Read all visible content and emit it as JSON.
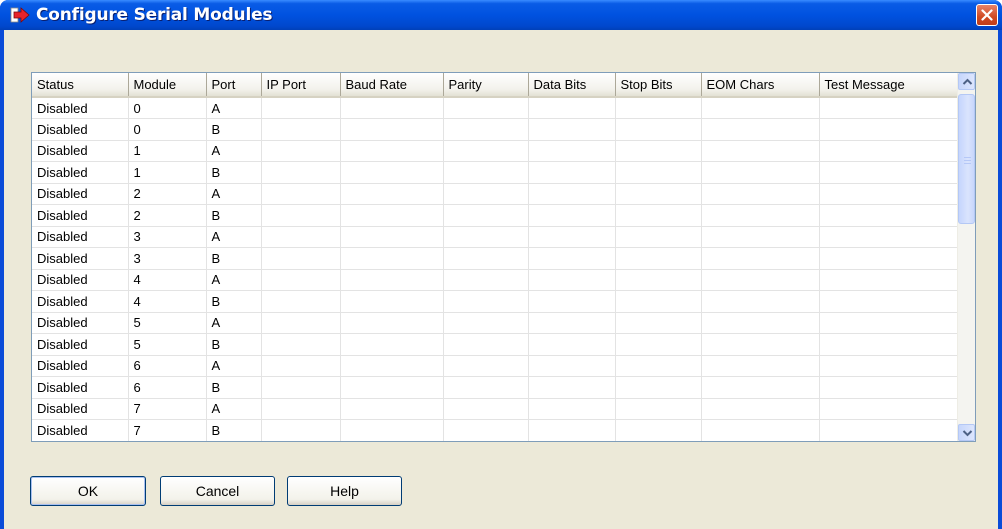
{
  "window": {
    "title": "Configure Serial Modules"
  },
  "grid": {
    "columns": [
      "Status",
      "Module",
      "Port",
      "IP Port",
      "Baud Rate",
      "Parity",
      "Data Bits",
      "Stop Bits",
      "EOM Chars",
      "Test Message"
    ],
    "rows": [
      [
        "Disabled",
        "0",
        "A",
        "",
        "",
        "",
        "",
        "",
        "",
        ""
      ],
      [
        "Disabled",
        "0",
        "B",
        "",
        "",
        "",
        "",
        "",
        "",
        ""
      ],
      [
        "Disabled",
        "1",
        "A",
        "",
        "",
        "",
        "",
        "",
        "",
        ""
      ],
      [
        "Disabled",
        "1",
        "B",
        "",
        "",
        "",
        "",
        "",
        "",
        ""
      ],
      [
        "Disabled",
        "2",
        "A",
        "",
        "",
        "",
        "",
        "",
        "",
        ""
      ],
      [
        "Disabled",
        "2",
        "B",
        "",
        "",
        "",
        "",
        "",
        "",
        ""
      ],
      [
        "Disabled",
        "3",
        "A",
        "",
        "",
        "",
        "",
        "",
        "",
        ""
      ],
      [
        "Disabled",
        "3",
        "B",
        "",
        "",
        "",
        "",
        "",
        "",
        ""
      ],
      [
        "Disabled",
        "4",
        "A",
        "",
        "",
        "",
        "",
        "",
        "",
        ""
      ],
      [
        "Disabled",
        "4",
        "B",
        "",
        "",
        "",
        "",
        "",
        "",
        ""
      ],
      [
        "Disabled",
        "5",
        "A",
        "",
        "",
        "",
        "",
        "",
        "",
        ""
      ],
      [
        "Disabled",
        "5",
        "B",
        "",
        "",
        "",
        "",
        "",
        "",
        ""
      ],
      [
        "Disabled",
        "6",
        "A",
        "",
        "",
        "",
        "",
        "",
        "",
        ""
      ],
      [
        "Disabled",
        "6",
        "B",
        "",
        "",
        "",
        "",
        "",
        "",
        ""
      ],
      [
        "Disabled",
        "7",
        "A",
        "",
        "",
        "",
        "",
        "",
        "",
        ""
      ],
      [
        "Disabled",
        "7",
        "B",
        "",
        "",
        "",
        "",
        "",
        "",
        ""
      ]
    ]
  },
  "buttons": {
    "ok": "OK",
    "cancel": "Cancel",
    "help": "Help"
  },
  "colors": {
    "titlebar": "#0052e0",
    "client": "#ece9d8",
    "close": "#d04a22"
  },
  "icons": {
    "app": "arrow-right-icon",
    "close": "close-icon",
    "scroll_up": "chevron-up-icon",
    "scroll_down": "chevron-down-icon"
  }
}
